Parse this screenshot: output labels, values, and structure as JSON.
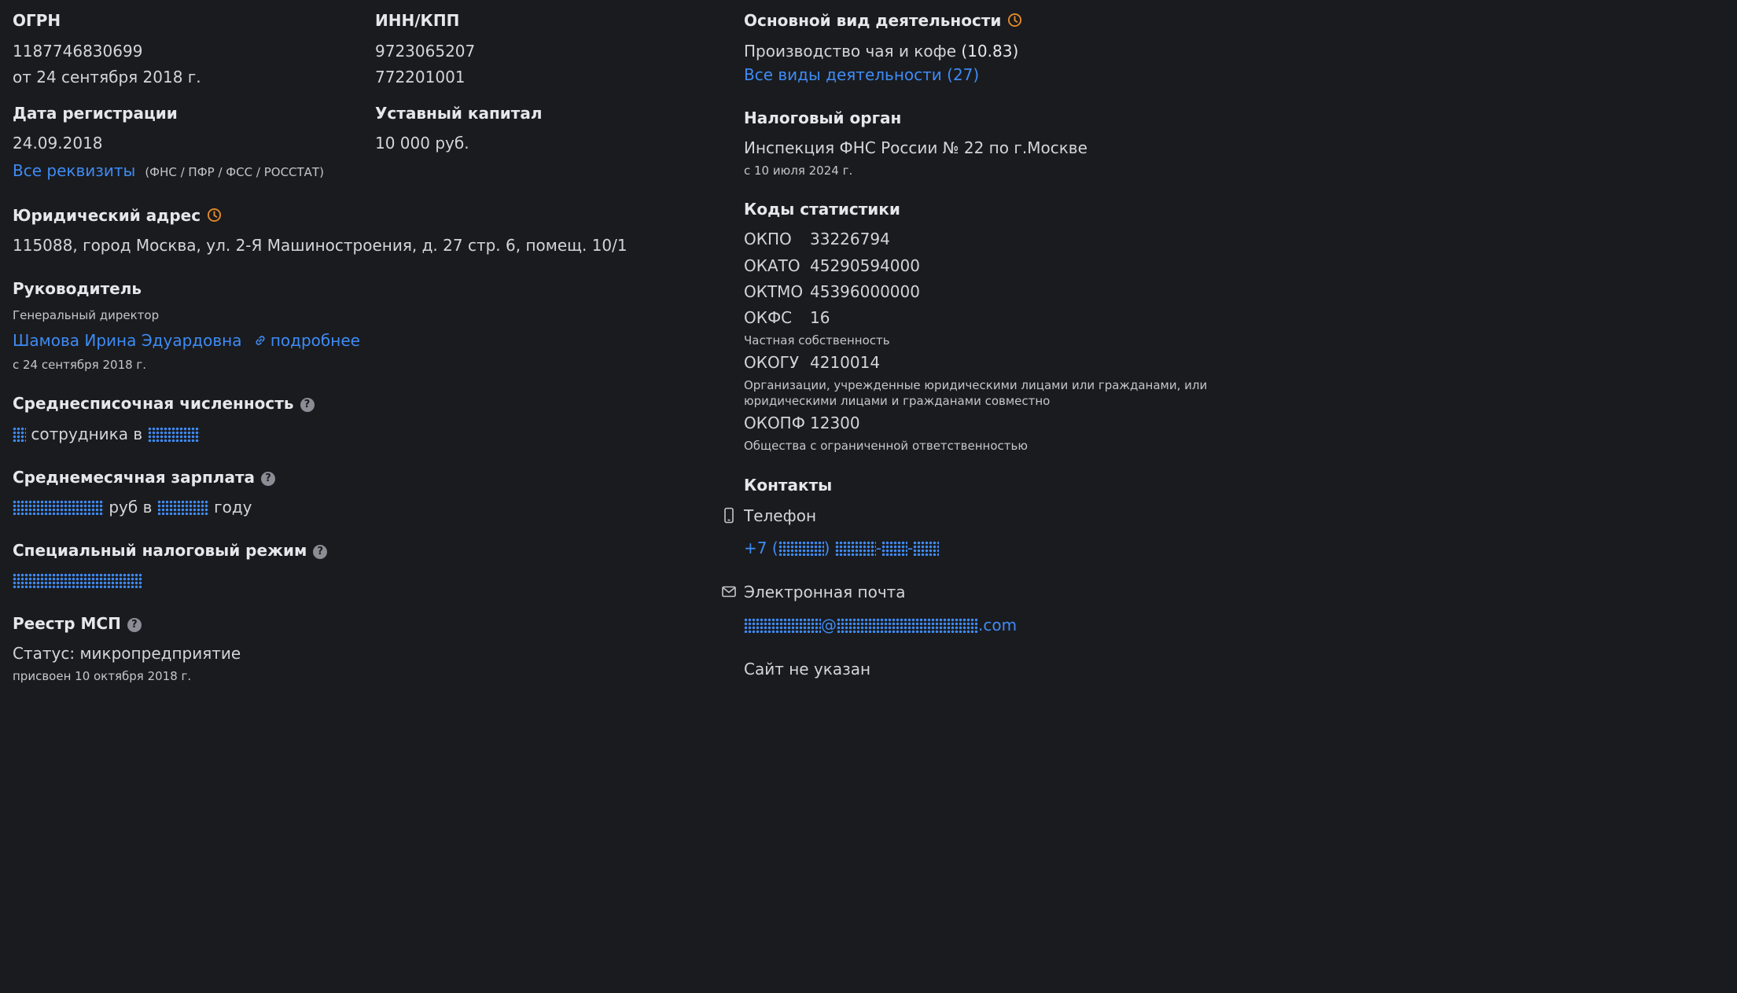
{
  "ogrn": {
    "label": "ОГРН",
    "value": "1187746830699",
    "date": "от 24 сентября 2018 г."
  },
  "inn_kpp": {
    "label": "ИНН/КПП",
    "inn": "9723065207",
    "kpp": "772201001"
  },
  "registration": {
    "label": "Дата регистрации",
    "value": "24.09.2018",
    "all_details_link": "Все реквизиты",
    "sources": "(ФНС / ПФР / ФСС / РОССТАТ)"
  },
  "capital": {
    "label": "Уставный капитал",
    "value": "10 000 руб."
  },
  "legal_address": {
    "label": "Юридический адрес",
    "value": "115088, город Москва, ул. 2-Я Машиностроения, д. 27 стр. 6, помещ. 10/1"
  },
  "director": {
    "label": "Руководитель",
    "position": "Генеральный директор",
    "name": "Шамова Ирина Эдуардовна",
    "more_link": "подробнее",
    "since": "с 24 сентября 2018 г."
  },
  "headcount": {
    "label": "Среднесписочная численность",
    "text_mid": "сотрудника в"
  },
  "salary": {
    "label": "Среднемесячная зарплата",
    "text_mid": "руб в",
    "text_end": "году"
  },
  "tax_regime": {
    "label": "Специальный налоговый режим"
  },
  "msp": {
    "label": "Реестр МСП",
    "status": "Статус: микропредприятие",
    "assigned": "присвоен 10 октября 2018 г."
  },
  "activity": {
    "label": "Основной вид деятельности",
    "value": "Производство чая и кофе",
    "code": "(10.83)",
    "all_link": "Все виды деятельности (27)"
  },
  "tax_authority": {
    "label": "Налоговый орган",
    "value": "Инспекция ФНС России № 22 по г.Москве",
    "since": "с 10 июля 2024 г."
  },
  "stats": {
    "label": "Коды статистики",
    "okpo": {
      "k": "ОКПО",
      "v": "33226794"
    },
    "okato": {
      "k": "ОКАТО",
      "v": "45290594000"
    },
    "oktmo": {
      "k": "ОКТМО",
      "v": "45396000000"
    },
    "okfs": {
      "k": "ОКФС",
      "v": "16",
      "desc": "Частная собственность"
    },
    "okogu": {
      "k": "ОКОГУ",
      "v": "4210014",
      "desc1": "Организации, учрежденные юридическими лицами или гражданами, или",
      "desc2": "юридическими лицами и гражданами совместно"
    },
    "okopf": {
      "k": "ОКОПФ",
      "v": "12300",
      "desc": "Общества с ограниченной ответственностью"
    }
  },
  "contacts": {
    "label": "Контакты",
    "phone_label": "Телефон",
    "phone_prefix": "+7 (",
    "phone_close": ")",
    "phone_dash": "-",
    "email_label": "Электронная почта",
    "email_at": "@",
    "email_suffix": ".com",
    "site": "Сайт не указан"
  },
  "colors": {
    "background": "#1a1b1e",
    "link": "#3e8bf5",
    "accent_clock": "#e38a2a",
    "help_icon": "#8a8d94"
  }
}
